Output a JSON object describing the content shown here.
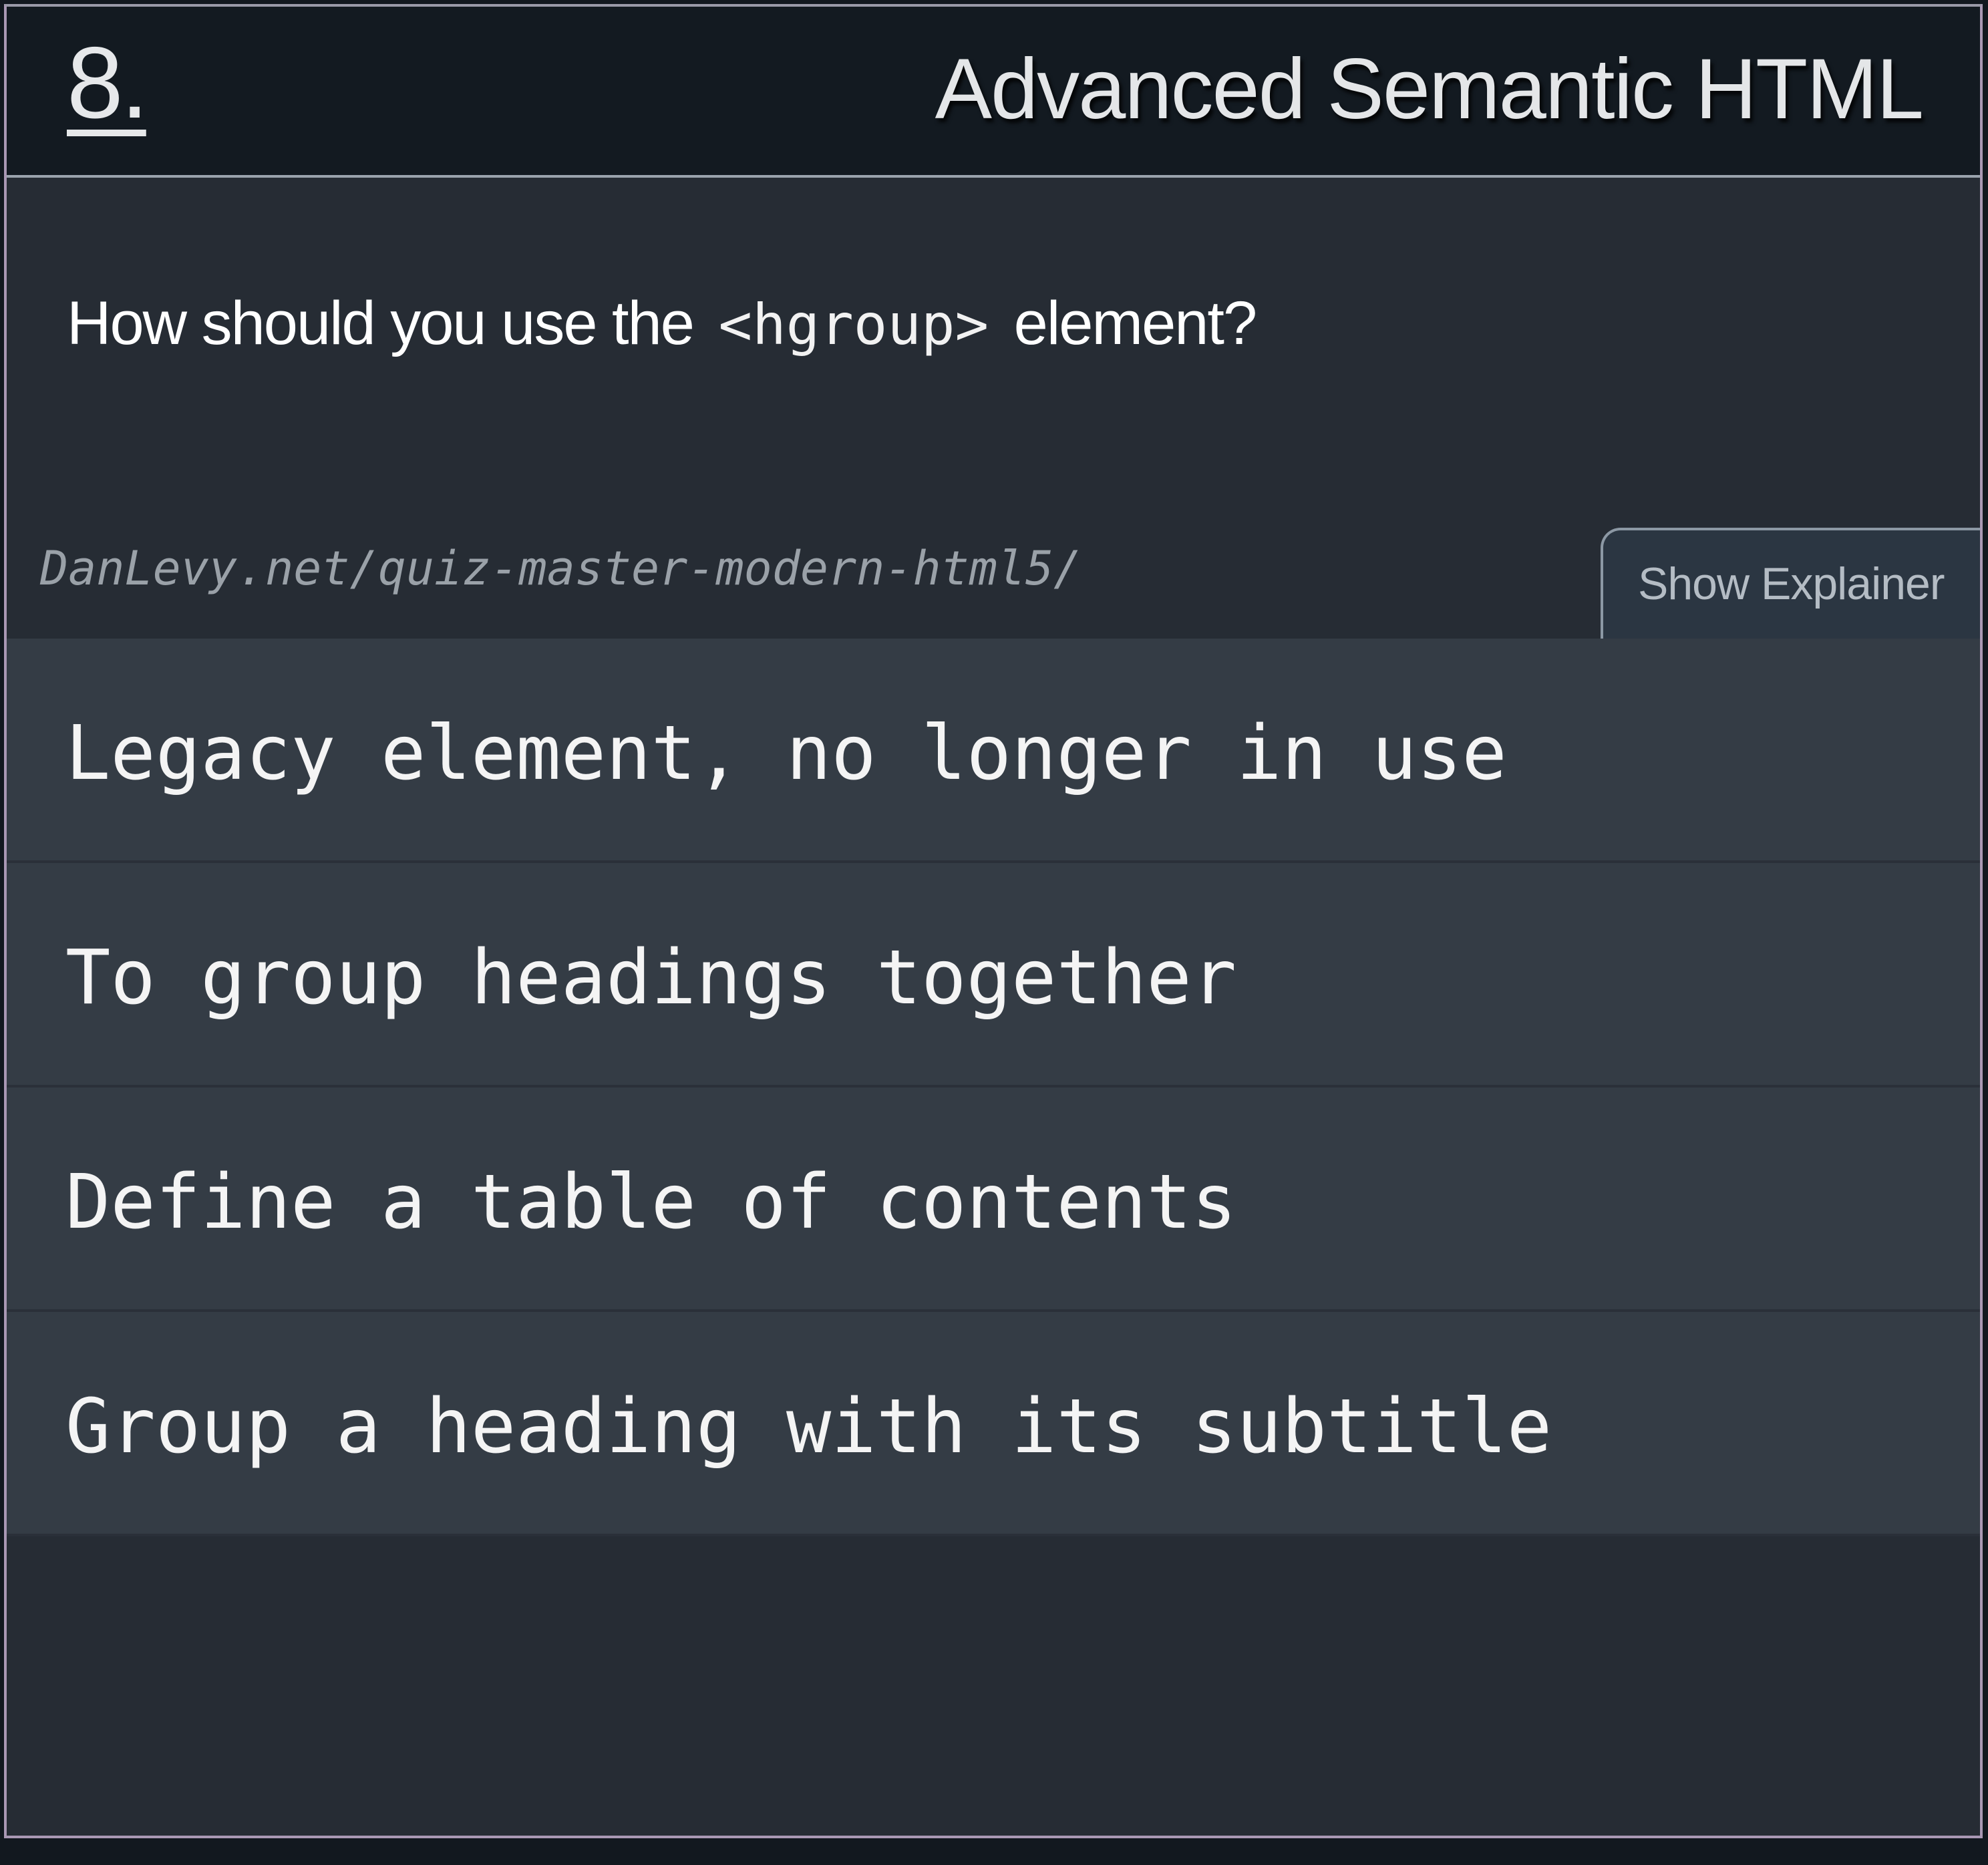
{
  "quiz": {
    "number": "8.",
    "title": "Advanced Semantic HTML",
    "question": {
      "before": "How should you use the",
      "code": "<hgroup>",
      "after": "element?"
    },
    "source": "DanLevy.net/quiz-master-modern-html5/",
    "explainer_label": "Show Explainer",
    "options": [
      {
        "label": "Legacy element, no longer in use"
      },
      {
        "label": "To group headings together"
      },
      {
        "label": "Define a table of contents"
      },
      {
        "label": "Group a heading with its subtitle"
      }
    ]
  },
  "colors": {
    "header_bg": "#131a21",
    "card_bg": "#262c34",
    "option_bg": "#343c45",
    "text": "#ffffff",
    "muted_text": "#9aa1a8"
  }
}
